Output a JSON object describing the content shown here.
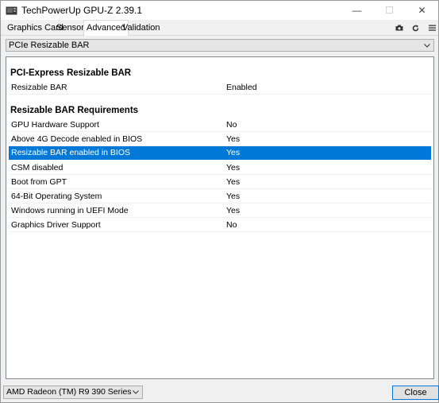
{
  "window": {
    "title": "TechPowerUp GPU-Z 2.39.1",
    "controls": {
      "minimize": "—",
      "maximize": "☐",
      "close": "✕"
    }
  },
  "tabs": [
    {
      "label": "Graphics Card",
      "active": false
    },
    {
      "label": "Sensors",
      "active": false
    },
    {
      "label": "Advanced",
      "active": true
    },
    {
      "label": "Validation",
      "active": false
    }
  ],
  "toolbar": {
    "icons": [
      "camera-icon",
      "refresh-icon",
      "menu-icon"
    ]
  },
  "section_select": {
    "value": "PCIe Resizable BAR"
  },
  "sections": {
    "pcie_heading": "PCI-Express Resizable BAR",
    "pcie_rows": [
      {
        "key": "Resizable BAR",
        "value": "Enabled"
      }
    ],
    "req_heading": "Resizable BAR Requirements",
    "req_rows": [
      {
        "key": "GPU Hardware Support",
        "value": "No"
      },
      {
        "key": "Above 4G Decode enabled in BIOS",
        "value": "Yes"
      },
      {
        "key": "Resizable BAR enabled in BIOS",
        "value": "Yes"
      },
      {
        "key": "CSM disabled",
        "value": "Yes"
      },
      {
        "key": "Boot from GPT",
        "value": "Yes"
      },
      {
        "key": "64-Bit Operating System",
        "value": "Yes"
      },
      {
        "key": "Windows running in UEFI Mode",
        "value": "Yes"
      },
      {
        "key": "Graphics Driver Support",
        "value": "No"
      }
    ],
    "selected_row": "Resizable BAR enabled in BIOS"
  },
  "footer": {
    "gpu_select": "AMD Radeon (TM) R9 390 Series",
    "close_label": "Close"
  },
  "colors": {
    "selection": "#0078d7",
    "accent_border": "#0078d7"
  }
}
